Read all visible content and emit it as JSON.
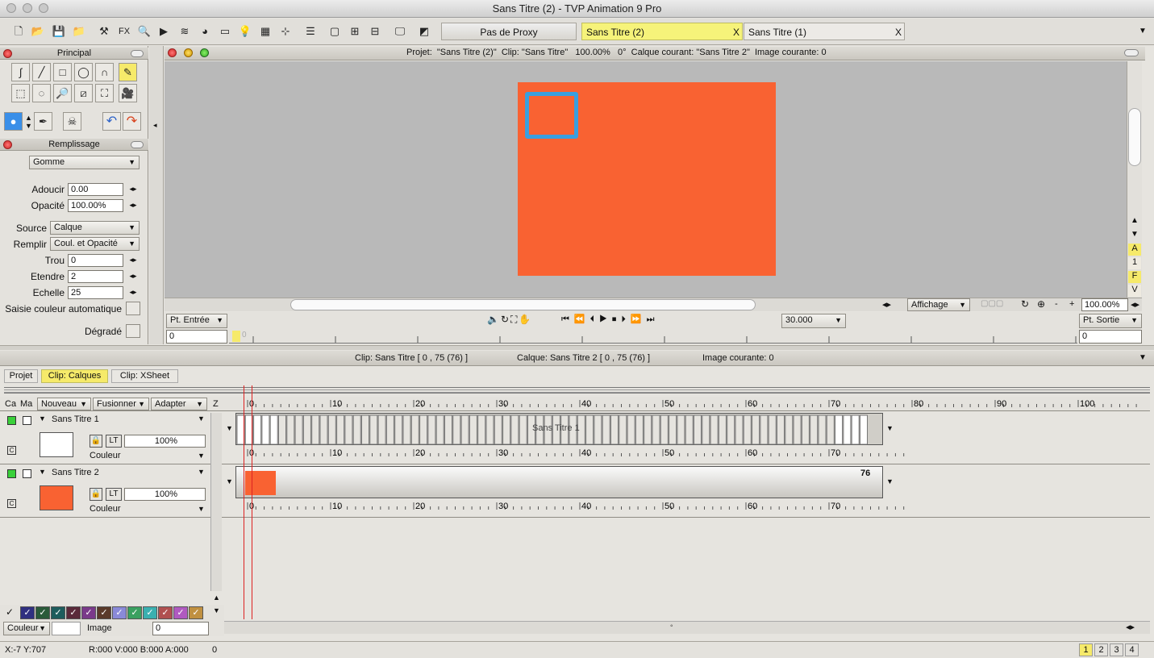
{
  "window": {
    "title": "Sans Titre (2) - TVP Animation 9 Pro"
  },
  "toolbar": {
    "proxy_label": "Pas de Proxy",
    "fx_label": "FX",
    "tabs": [
      {
        "label": "Sans Titre (2)",
        "active": true
      },
      {
        "label": "Sans Titre (1)",
        "active": false
      }
    ],
    "tab_close": "X"
  },
  "principal": {
    "title": "Principal"
  },
  "fill": {
    "title": "Remplissage",
    "mode": "Gomme",
    "adoucir_label": "Adoucir",
    "adoucir_value": "0.00",
    "opacite_label": "Opacité",
    "opacite_value": "100.00%",
    "source_label": "Source",
    "source_value": "Calque",
    "remplir_label": "Remplir",
    "remplir_value": "Coul. et Opacité",
    "trou_label": "Trou",
    "trou_value": "0",
    "etendre_label": "Etendre",
    "etendre_value": "2",
    "echelle_label": "Echelle",
    "echelle_value": "25",
    "saisie_label": "Saisie couleur automatique",
    "degrade_label": "Dégradé"
  },
  "viewport": {
    "info": "Projet:  \"Sans Titre (2)\"  Clip: \"Sans Titre\"   100.00%   0°  Calque courant: \"Sans Titre 2\"  Image courante: 0",
    "canvas_color": "#f96232",
    "rect_color": "#3a9fdf",
    "side_letters": [
      "A",
      "1",
      "F",
      "V"
    ],
    "affichage_label": "Affichage",
    "zoom_value": "100.00%",
    "dash": "-",
    "plus": "+",
    "pt_entree": "Pt. Entrée",
    "pt_sortie": "Pt. Sortie",
    "fps_value": "30.000",
    "in_value": "0",
    "out_value": "0",
    "slider_mark": "0"
  },
  "timeline": {
    "clip_info": "Clip: Sans Titre [ 0 , 75  (76) ]",
    "layer_info": "Calque: Sans Titre 2 [ 0 , 75  (76) ]",
    "image_info": "Image courante: 0",
    "tabs": [
      {
        "label": "Projet"
      },
      {
        "label": "Clip: Calques",
        "active": true
      },
      {
        "label": "Clip: XSheet"
      }
    ],
    "columns": {
      "ca": "Ca",
      "ma": "Ma",
      "nouveau": "Nouveau",
      "fusionner": "Fusionner",
      "adapter": "Adapter",
      "z": "Z"
    },
    "ruler_ticks": [
      "0",
      "10",
      "20",
      "30",
      "40",
      "50",
      "60",
      "70",
      "80",
      "90",
      "100"
    ],
    "layer_ticks": [
      "0",
      "10",
      "20",
      "30",
      "40",
      "50",
      "60",
      "70"
    ],
    "layers": [
      {
        "name": "Sans Titre 1",
        "opacity": "100%",
        "mode": "Couleur",
        "lt": "LT",
        "c": "C",
        "bar_label": "Sans Titre 1",
        "thumb": "#ffffff"
      },
      {
        "name": "Sans Titre 2",
        "opacity": "100%",
        "mode": "Couleur",
        "lt": "LT",
        "c": "C",
        "end_frame": "76",
        "thumb": "#f96232"
      }
    ],
    "swatch_colors": [
      "#303080",
      "#2a5a3a",
      "#1e5d5d",
      "#5a2a3a",
      "#7a3a8a",
      "#5a3a2a",
      "#8a8ad8",
      "#3aa060",
      "#3ab0b0",
      "#b05050",
      "#b05ac0",
      "#c09040"
    ],
    "bottom_couleur": "Couleur",
    "bottom_image": "Image",
    "bottom_value": "0"
  },
  "status": {
    "coords": "X:-7  Y:707",
    "rgba": "R:000 V:000 B:000 A:000",
    "value": "0",
    "pages": [
      "1",
      "2",
      "3",
      "4"
    ]
  }
}
